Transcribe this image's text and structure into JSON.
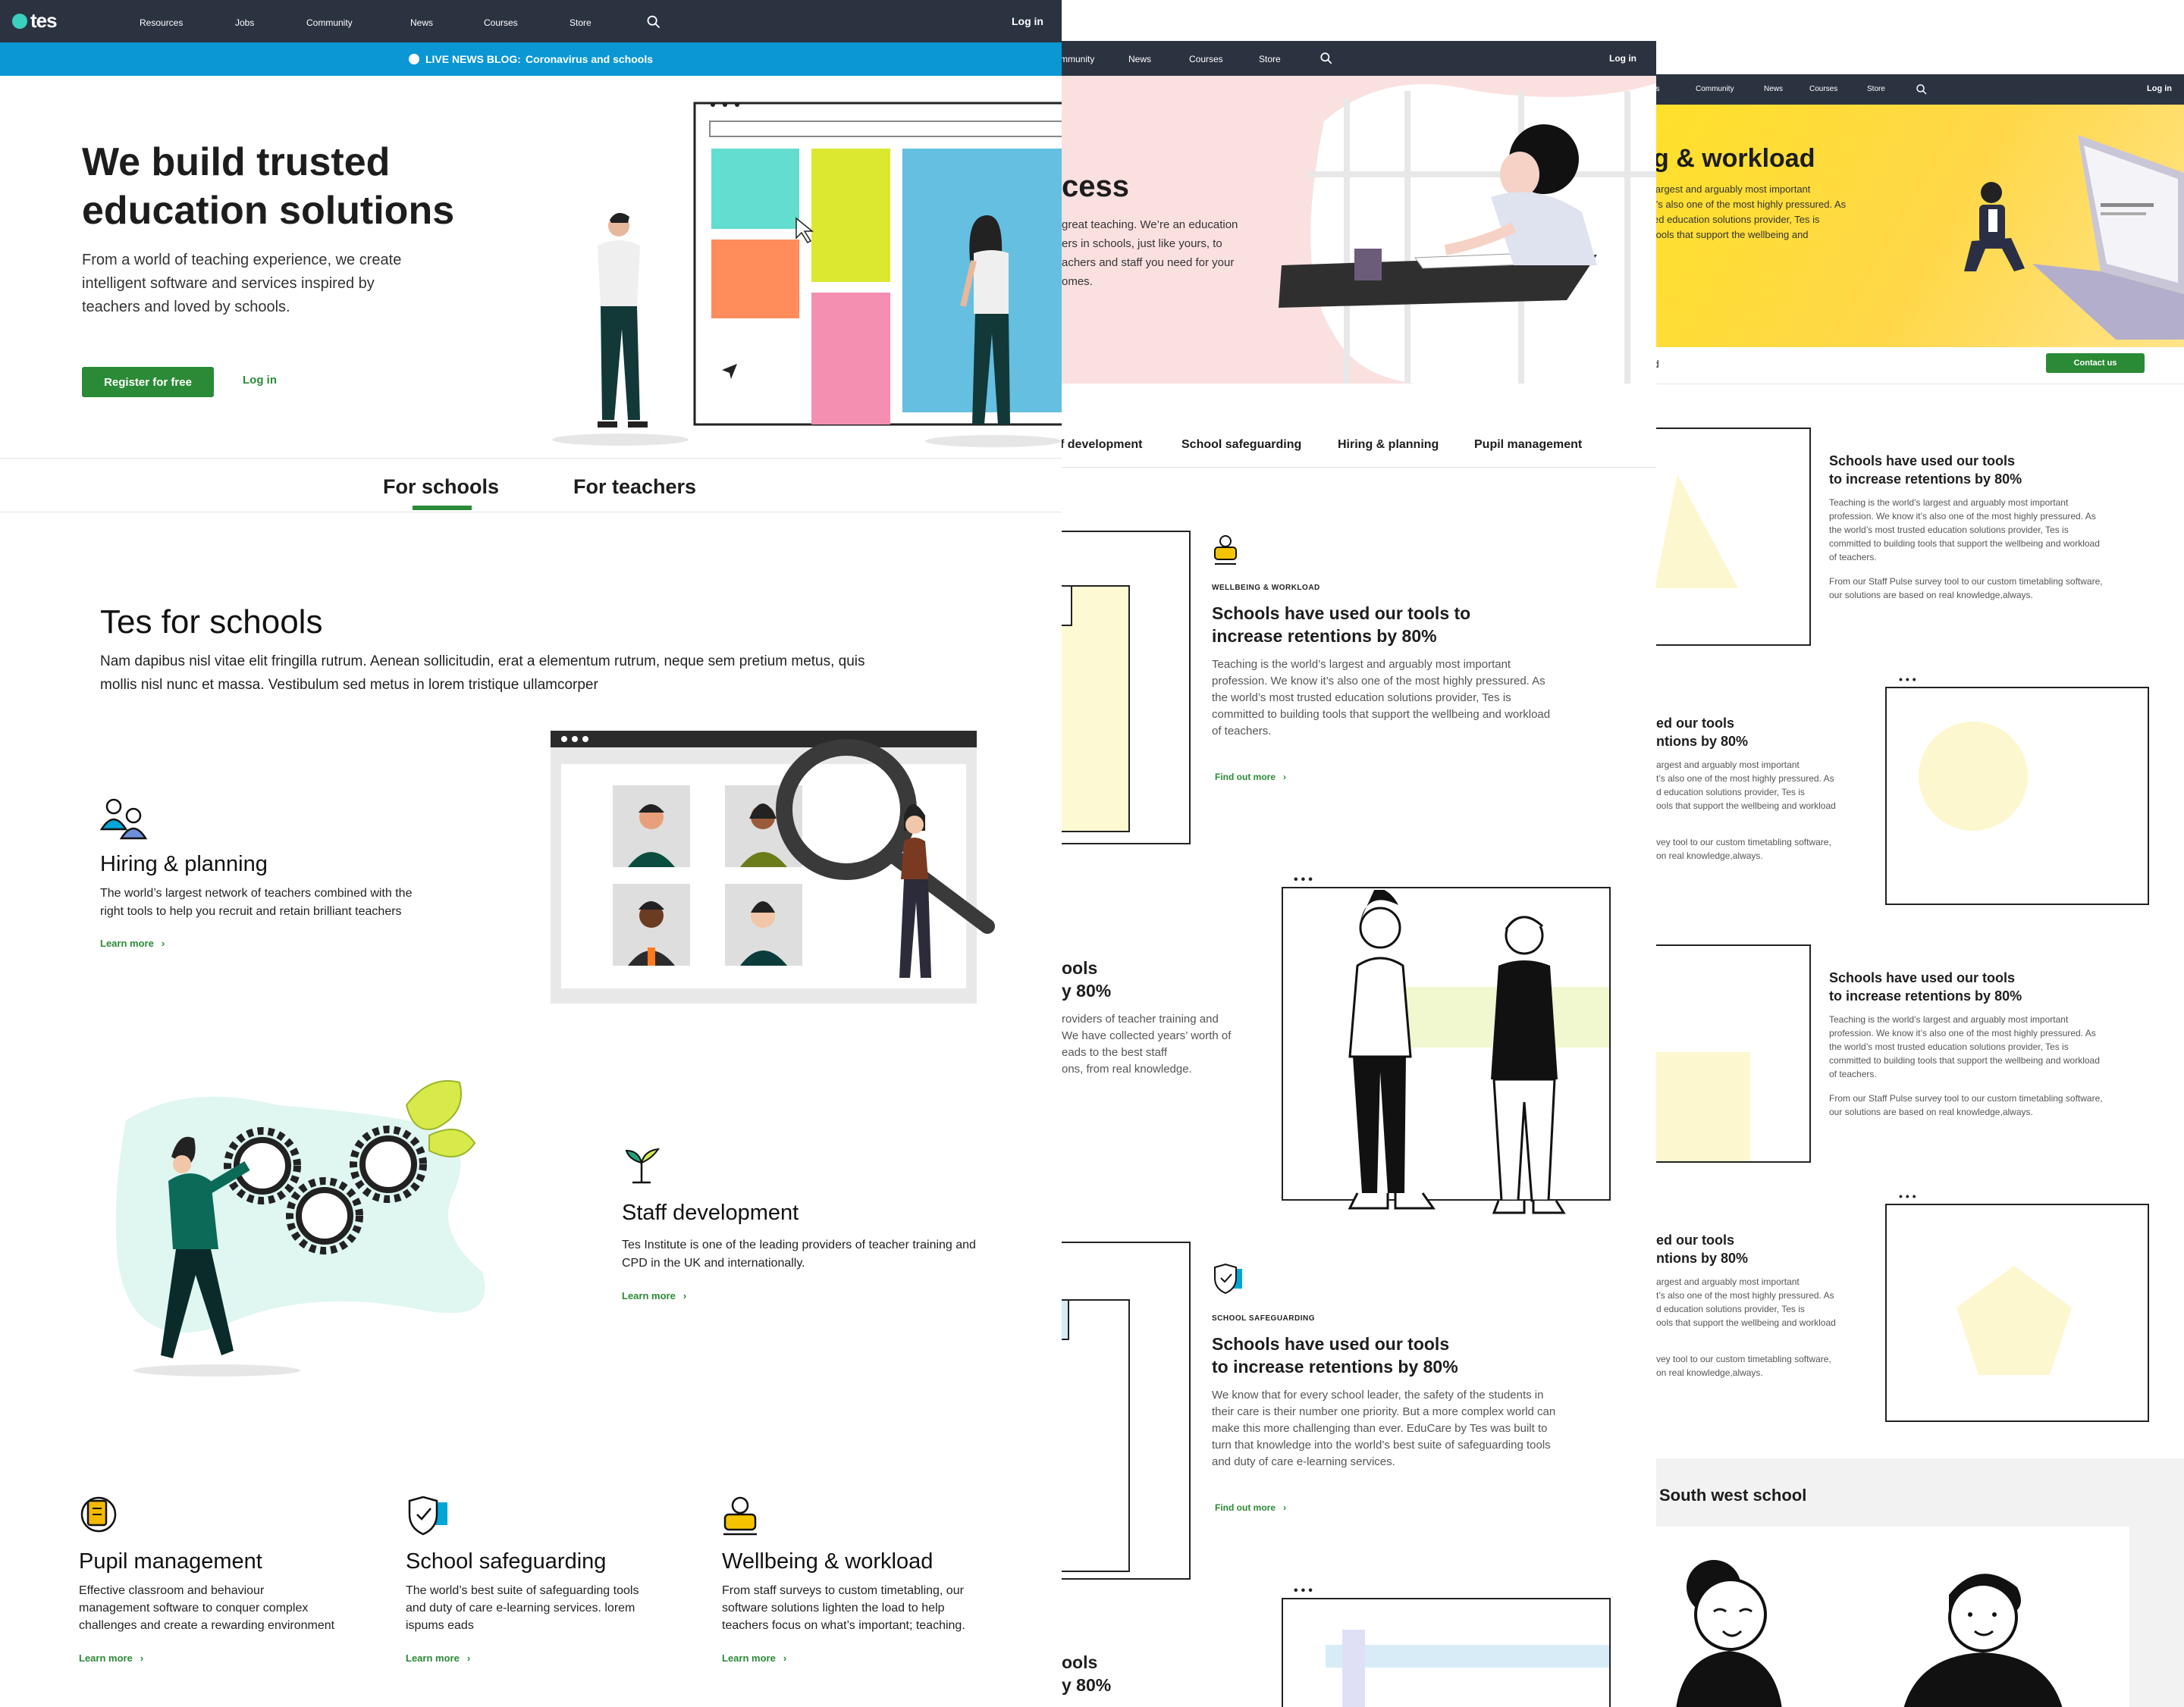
{
  "p1": {
    "logo": "tes",
    "nav": [
      "Resources",
      "Jobs",
      "Community",
      "News",
      "Courses",
      "Store"
    ],
    "login": "Log in",
    "banner": {
      "label": "LIVE NEWS BLOG:",
      "text": "Coronavirus and schools"
    },
    "hero": {
      "title_l1": "We build trusted",
      "title_l2": "education solutions",
      "desc_l1": "From a world of teaching experience, we create",
      "desc_l2": "intelligent software and services inspired by",
      "desc_l3": "teachers and loved by schools.",
      "register": "Register for free",
      "login": "Log in"
    },
    "tabs": [
      "For schools",
      "For teachers"
    ],
    "section": {
      "title": "Tes for schools",
      "desc_l1": "Nam dapibus nisl vitae elit fringilla rutrum. Aenean sollicitudin, erat a elementum rutrum, neque sem pretium metus, quis",
      "desc_l2": "mollis nisl nunc et massa. Vestibulum sed metus in lorem tristique ullamcorper"
    },
    "hiring": {
      "title": "Hiring & planning",
      "l1": "The world’s largest network of teachers combined with the",
      "l2": "right tools to help you recruit and retain brilliant teachers",
      "link": "Learn more"
    },
    "staff": {
      "title": "Staff development",
      "l1": "Tes Institute is one of the leading providers of teacher training and",
      "l2": "CPD in the UK and internationally.",
      "link": "Learn more"
    },
    "cards": [
      {
        "title": "Pupil management",
        "l1": "Effective classroom and behaviour",
        "l2": "management software to conquer complex",
        "l3": "challenges and create a rewarding environment",
        "link": "Learn more"
      },
      {
        "title": "School safeguarding",
        "l1": "The world’s best suite of safeguarding tools",
        "l2": "and duty of care e-learning services. lorem",
        "l3": "ispums eads",
        "link": "Learn more"
      },
      {
        "title": "Wellbeing & workload",
        "l1": "From staff surveys to custom timetabling, our",
        "l2": "software solutions lighten the load to help",
        "l3": "teachers focus on what’s important; teaching.",
        "link": "Learn more"
      }
    ]
  },
  "p2": {
    "nav": [
      "mmunity",
      "News",
      "Courses",
      "Store"
    ],
    "login": "Log in",
    "hero": {
      "title": "cess",
      "l1": "great teaching. We’re an education",
      "l2": "ers in schools, just like yours, to",
      "l3": "achers and staff you need for your",
      "l4": "omes."
    },
    "tabs": [
      "f development",
      "School safeguarding",
      "Hiring & planning",
      "Pupil management"
    ],
    "block1": {
      "kicker": "WELLBEING & WORKLOAD",
      "title_l1": "Schools have used our tools to",
      "title_l2": "increase retentions by 80%",
      "l1": "Teaching is the world’s largest and arguably most important",
      "l2": "profession. We know it’s also one of the most highly pressured. As",
      "l3": "the world’s most trusted education solutions provider, Tes is",
      "l4": "committed to building tools that support the wellbeing and workload",
      "l5": "of teachers.",
      "link": "Find out more"
    },
    "block2": {
      "t1": "ools",
      "t2": "y 80%",
      "l1": "roviders of teacher training and",
      "l2": "We have collected years’ worth of",
      "l3": "eads to the best staff",
      "l4": "ons, from real knowledge."
    },
    "block3": {
      "kicker": "SCHOOL SAFEGUARDING",
      "title_l1": "Schools have used our tools",
      "title_l2": "to increase retentions by 80%",
      "l1": "We know that for every school leader, the safety of the students in",
      "l2": "their care is their number one priority. But a more complex world can",
      "l3": "make this more challenging than ever. EduCare by Tes was built to",
      "l4": "turn that knowledge into the world’s best suite of safeguarding tools",
      "l5": "and duty of care e-learning services.",
      "link": "Find out more"
    },
    "block4": {
      "t1": "ools",
      "t2": "y 80%"
    }
  },
  "p3": {
    "nav": [
      "bs",
      "Community",
      "News",
      "Courses",
      "Store"
    ],
    "login": "Log in",
    "hero": {
      "title": "g & workload",
      "l1": "largest and arguably most important",
      "l2": "t’s also one of the most highly pressured. As",
      "l3": "ed education solutions provider, Tes is",
      "l4": "tools that support the wellbeing and"
    },
    "sub_left": "d",
    "contact": "Contact us",
    "blockA": {
      "title_l1": "Schools have used our tools",
      "title_l2": "to increase retentions by 80%",
      "l1": "Teaching is the world’s largest and arguably most important",
      "l2": "profession. We know it’s also one of the most highly pressured. As",
      "l3": "the world’s most trusted education solutions provider, Tes is",
      "l4": "committed to building tools that support the wellbeing and workload",
      "l5": "of teachers.",
      "m1": "From our Staff Pulse survey tool to our custom timetabling software,",
      "m2": "our solutions are based on real knowledge,always."
    },
    "blockB": {
      "title_l1": "ed our tools",
      "title_l2": "ntions by 80%",
      "l1": "argest and arguably most important",
      "l2": "t’s also one of the most highly pressured. As",
      "l3": "d education solutions provider, Tes is",
      "l4": "ools that support the wellbeing and workload",
      "m1": "vey tool to our custom timetabling software,",
      "m2": "on real knowledge,always."
    },
    "south": "South west school"
  }
}
